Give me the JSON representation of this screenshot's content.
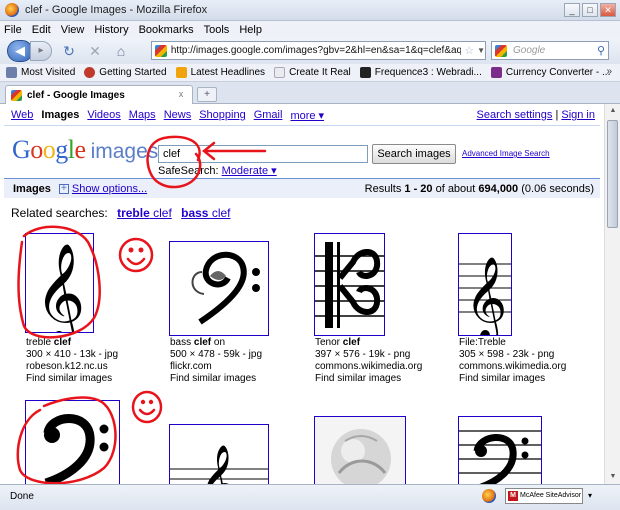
{
  "window": {
    "title": "clef - Google Images - Mozilla Firefox",
    "min": "_",
    "max": "□",
    "close": "✕"
  },
  "menu": [
    "File",
    "Edit",
    "View",
    "History",
    "Bookmarks",
    "Tools",
    "Help"
  ],
  "nav": {
    "back": "◀",
    "forward": "▸",
    "reload": "↻",
    "stop": "✕",
    "home": "⌂",
    "url": "http://images.google.com/images?gbv=2&hl=en&sa=1&q=clef&aq",
    "search_placeholder": "Google"
  },
  "bookmarks": [
    {
      "label": "Most Visited",
      "color": "#6b7fa8"
    },
    {
      "label": "Getting Started",
      "color": "#c0392b"
    },
    {
      "label": "Latest Headlines",
      "color": "#f0a30a"
    },
    {
      "label": "Create It Real",
      "color": "#e8ecef"
    },
    {
      "label": "Frequence3 : Webradi...",
      "color": "#222222"
    },
    {
      "label": "Currency Converter - ...",
      "color": "#7b2d8b"
    }
  ],
  "bookmarks_more": "»",
  "tab": {
    "label": "clef - Google Images",
    "close": "x",
    "new": "+"
  },
  "gbar": {
    "links": [
      "Web",
      "Images",
      "Videos",
      "Maps",
      "News",
      "Shopping",
      "Gmail",
      "more ▾"
    ],
    "active": "Images",
    "settings": "Search settings",
    "separator": "|",
    "signin": "Sign in"
  },
  "logo": {
    "letters": [
      "G",
      "o",
      "o",
      "g",
      "l",
      "e"
    ],
    "colors": [
      "#3366cc",
      "#d9361f",
      "#f3b513",
      "#3366cc",
      "#33a329",
      "#d9361f"
    ],
    "suffix": "images"
  },
  "search": {
    "query": "clef",
    "button": "Search images",
    "advanced": "Advanced Image Search",
    "safesearch_label": "SafeSearch:",
    "safesearch_value": "Moderate ▾"
  },
  "results_bar": {
    "title": "Images",
    "plus": "+",
    "show_options": "Show options...",
    "stats_prefix": "Results ",
    "stats_range": "1 - 20",
    "stats_mid": " of about ",
    "stats_total": "694,000",
    "stats_time": " (0.06 seconds)"
  },
  "related": {
    "label": "Related searches:",
    "items": [
      {
        "bold": "treble",
        "rest": " clef"
      },
      {
        "bold": "bass",
        "rest": " clef"
      }
    ]
  },
  "results": [
    {
      "title_pre": "treble ",
      "title_bold": "clef",
      "title_post": "",
      "meta": "300 × 410 - 13k - jpg",
      "source": "robeson.k12.nc.us",
      "similar": "Find similar images"
    },
    {
      "title_pre": "bass ",
      "title_bold": "clef",
      "title_post": " on",
      "meta": "500 × 478 - 59k - jpg",
      "source": "flickr.com",
      "similar": "Find similar images"
    },
    {
      "title_pre": "Tenor ",
      "title_bold": "clef",
      "title_post": "",
      "meta": "397 × 576 - 19k - png",
      "source": "commons.wikimedia.org",
      "similar": "Find similar images"
    },
    {
      "title_pre": "File:Treble",
      "title_bold": "",
      "title_post": "",
      "meta": "305 × 598 - 23k - png",
      "source": "commons.wikimedia.org",
      "similar": "Find similar images"
    }
  ],
  "status": {
    "text": "Done",
    "addon": "McAfee SiteAdvisor",
    "addon_mark": "M",
    "addon_drop": "▾"
  },
  "colors": {
    "link": "#2200cc",
    "source": "#008000",
    "annotation_red": "#e8141c"
  }
}
